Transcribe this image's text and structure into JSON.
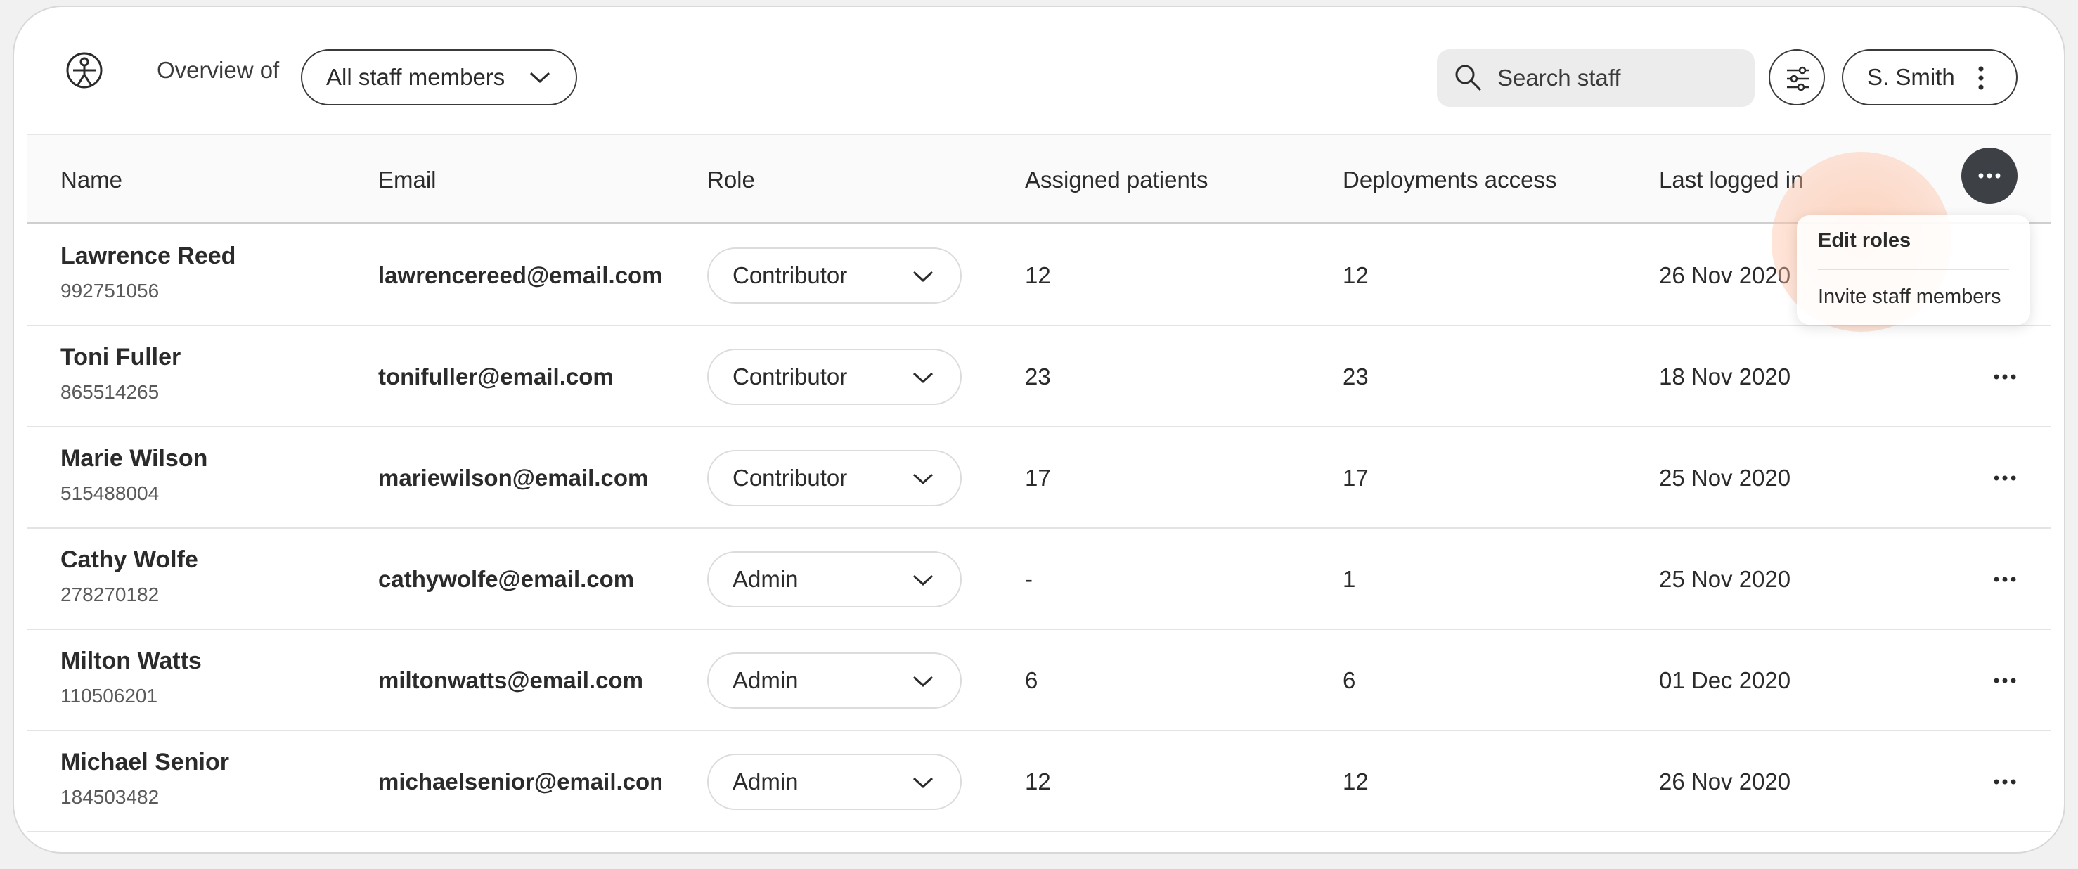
{
  "header": {
    "overview_label": "Overview of",
    "staff_filter": "All staff members",
    "search_placeholder": "Search staff",
    "user_name": "S. Smith"
  },
  "table": {
    "columns": [
      "Name",
      "Email",
      "Role",
      "Assigned patients",
      "Deployments access",
      "Last logged in"
    ],
    "rows": [
      {
        "name": "Lawrence Reed",
        "id": "992751056",
        "email": "lawrencereed@email.com",
        "role": "Contributor",
        "assigned": "12",
        "deployments": "12",
        "last_login": "26 Nov 2020"
      },
      {
        "name": "Toni Fuller",
        "id": "865514265",
        "email": "tonifuller@email.com",
        "role": "Contributor",
        "assigned": "23",
        "deployments": "23",
        "last_login": "18 Nov 2020"
      },
      {
        "name": "Marie Wilson",
        "id": "515488004",
        "email": "mariewilson@email.com",
        "role": "Contributor",
        "assigned": "17",
        "deployments": "17",
        "last_login": "25 Nov 2020"
      },
      {
        "name": "Cathy Wolfe",
        "id": "278270182",
        "email": "cathywolfe@email.com",
        "role": "Admin",
        "assigned": "-",
        "deployments": "1",
        "last_login": "25 Nov 2020"
      },
      {
        "name": "Milton Watts",
        "id": "110506201",
        "email": "miltonwatts@email.com",
        "role": "Admin",
        "assigned": "6",
        "deployments": "6",
        "last_login": "01 Dec 2020"
      },
      {
        "name": "Michael Senior",
        "id": "184503482",
        "email": "michaelsenior@email.com",
        "role": "Admin",
        "assigned": "12",
        "deployments": "12",
        "last_login": "26 Nov 2020"
      }
    ]
  },
  "dropdown_menu": {
    "items": [
      "Edit roles",
      "Invite staff members"
    ]
  },
  "colors": {
    "menu_button_bg": "#3d4045",
    "highlight": "#ffb28c",
    "border": "#3a3a3a"
  }
}
